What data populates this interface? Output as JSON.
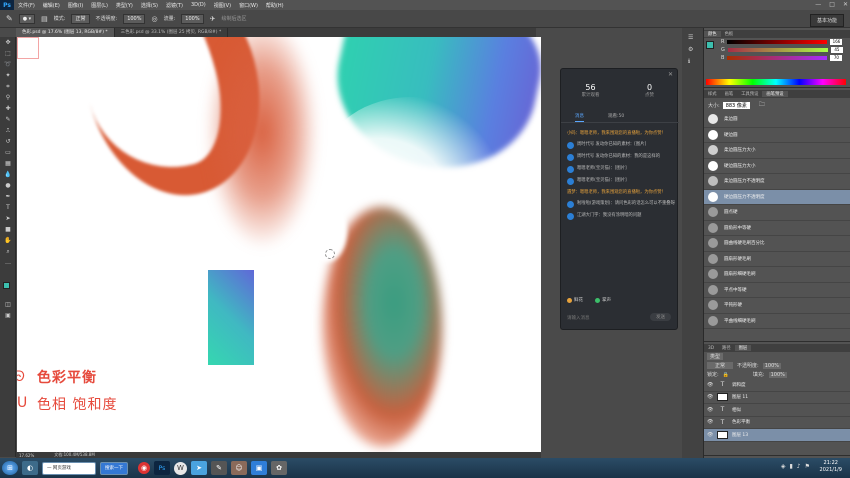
{
  "app": {
    "logo": "Ps",
    "menu": [
      "文件(F)",
      "编辑(E)",
      "图像(I)",
      "图层(L)",
      "类型(Y)",
      "选择(S)",
      "滤镜(T)",
      "3D(D)",
      "视图(V)",
      "窗口(W)",
      "帮助(H)"
    ],
    "window_controls": [
      "—",
      "□",
      "✕"
    ],
    "workspace_button": "基本功能"
  },
  "options_bar": {
    "mode_label": "模式:",
    "mode_value": "正常",
    "opacity_label": "不透明度:",
    "opacity_value": "100%",
    "flow_label": "流量:",
    "flow_value": "100%",
    "smoothing_label": "绘制后选区"
  },
  "doc_tabs": [
    {
      "label": "色彩.psd @ 17.6% (图层 13, RGB/8#) *",
      "active": true
    },
    {
      "label": "三色彩.psd @ 33.1% (图层 25 拷贝, RGB/8#) *",
      "active": false
    }
  ],
  "status_bar": {
    "zoom": "17.62%",
    "doc_size": "文档:100.4M/538.8M"
  },
  "canvas": {
    "annotation_line1": "色彩平衡",
    "annotation_line2": "色相 饱和度",
    "annotation_color": "#e64a3c"
  },
  "chat": {
    "stats": [
      {
        "value": "56",
        "label": "累计观看"
      },
      {
        "value": "0",
        "label": "点赞"
      }
    ],
    "tabs": [
      "消息",
      "观看:50"
    ],
    "messages": [
      {
        "text": "小码：嗯嗯老师，我来围观您的直播啦，为你点赞！",
        "style": "yellow",
        "avatar": false
      },
      {
        "text": "周时代号 发动你已知的素材：[图片]",
        "style": "normal",
        "avatar": true
      },
      {
        "text": "周时代号 发动你已知的素材：我的是这样的",
        "style": "normal",
        "avatar": true
      },
      {
        "text": "嗯嗯老师(宝贝猫)：[图片]",
        "style": "normal",
        "avatar": true
      },
      {
        "text": "嗯嗯老师(宝贝猫)：[图片]",
        "style": "normal",
        "avatar": true
      },
      {
        "text": "遇梦：嗯嗯老师，我来围观您的直播啦，为你点赞！",
        "style": "yellow",
        "avatar": false
      },
      {
        "text": "啦啦啦(游戏策划)：请问色彩的话怎么可以不重叠呀",
        "style": "normal",
        "avatar": true
      },
      {
        "text": "江湖大门宇：我没有涂明暗的问题",
        "style": "normal",
        "avatar": true
      }
    ],
    "gifts": [
      {
        "label": "鲜花",
        "color": "#e6a23c"
      },
      {
        "label": "掌声",
        "color": "#3cbf6a"
      }
    ],
    "input_placeholder": "请输入消息",
    "send_label": "发送"
  },
  "color_panel": {
    "tabs": [
      "颜色",
      "色板"
    ],
    "sliders": [
      {
        "label": "R",
        "value": "166"
      },
      {
        "label": "G",
        "value": "45"
      },
      {
        "label": "B",
        "value": "70"
      }
    ]
  },
  "brush_panel": {
    "tabs": [
      "样式",
      "画笔",
      "工具预设",
      "画笔预设"
    ],
    "size_label": "大小:",
    "size_value": "883 像素",
    "brushes": [
      {
        "label": "柔边圆",
        "color": "#e8e8e8",
        "selected": false
      },
      {
        "label": "硬边圆",
        "color": "#ffffff",
        "selected": false
      },
      {
        "label": "柔边圆压力大小",
        "color": "#cfcfcf",
        "selected": false
      },
      {
        "label": "硬边圆压力大小",
        "color": "#ffffff",
        "selected": false
      },
      {
        "label": "柔边圆压力不透明度",
        "color": "#bdbdbd",
        "selected": false
      },
      {
        "label": "硬边圆压力不透明度",
        "color": "#ffffff",
        "selected": true
      },
      {
        "label": "圆点硬",
        "color": "#9a9a9a",
        "selected": false
      },
      {
        "label": "圆角形中等硬",
        "color": "#9a9a9a",
        "selected": false
      },
      {
        "label": "圆曲线硬毛刷百分比",
        "color": "#9a9a9a",
        "selected": false
      },
      {
        "label": "圆扇形硬毛刷",
        "color": "#9a9a9a",
        "selected": false
      },
      {
        "label": "圆扇形细硬毛刷",
        "color": "#9a9a9a",
        "selected": false
      },
      {
        "label": "平点中等硬",
        "color": "#9a9a9a",
        "selected": false
      },
      {
        "label": "平钝形硬",
        "color": "#9a9a9a",
        "selected": false
      },
      {
        "label": "平曲线细硬毛刷",
        "color": "#9a9a9a",
        "selected": false
      }
    ]
  },
  "layers_panel": {
    "tabs": [
      "3D",
      "路径",
      "图层"
    ],
    "filter_label": "类型",
    "blend_mode": "正常",
    "opacity_label": "不透明度:",
    "opacity_value": "100%",
    "lock_label": "锁定:",
    "fill_label": "填充:",
    "fill_value": "100%",
    "layers": [
      {
        "name": "调和度",
        "kind": "text",
        "selected": false
      },
      {
        "name": "图层 11",
        "kind": "image",
        "selected": false
      },
      {
        "name": "相似",
        "kind": "text",
        "selected": false
      },
      {
        "name": "色彩平衡",
        "kind": "text",
        "selected": false
      },
      {
        "name": "图层 13",
        "kind": "image",
        "selected": true
      }
    ]
  },
  "taskbar": {
    "search_label": "一 网页游戏",
    "search_btn": "搜索一下",
    "time": "21:22",
    "date": "2021/1/9"
  }
}
